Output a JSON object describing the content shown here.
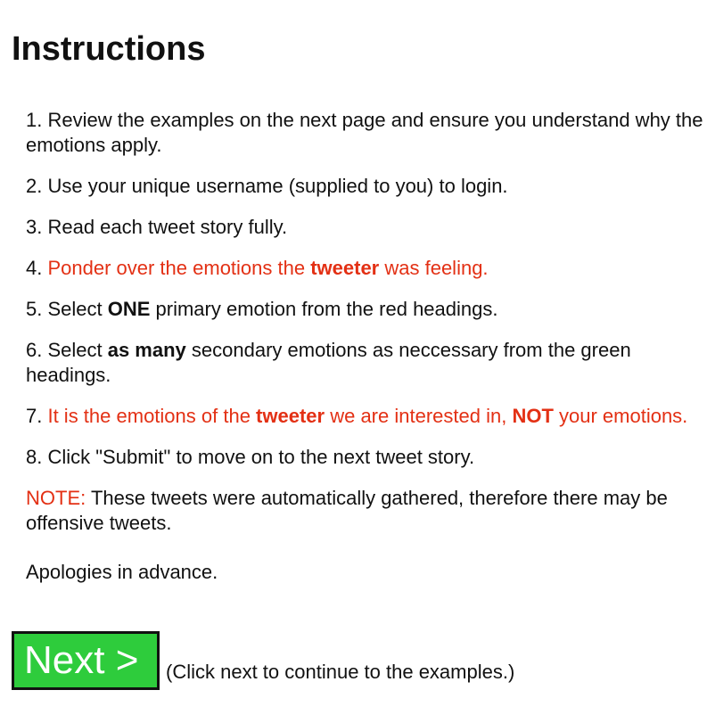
{
  "page": {
    "title": "Instructions"
  },
  "instructions": {
    "step1": {
      "text": "1. Review the examples on the next page and ensure you understand why the emotions apply."
    },
    "step2": {
      "text": "2. Use your unique username (supplied to you) to login."
    },
    "step3": {
      "text": "3. Read each tweet story fully."
    },
    "step4": {
      "prefix": "4. ",
      "text_before": "Ponder over the emotions the ",
      "bold": "tweeter",
      "text_after": " was feeling."
    },
    "step5": {
      "text_before": "5. Select ",
      "bold": "ONE",
      "text_after": " primary emotion from the red headings."
    },
    "step6": {
      "text_before": "6. Select ",
      "bold": "as many",
      "text_after": " secondary emotions as neccessary from the green headings."
    },
    "step7": {
      "prefix": "7. ",
      "text_before": "It is the emotions of the ",
      "bold1": "tweeter",
      "text_middle": " we are interested in, ",
      "bold2": "NOT",
      "text_after": " your emotions."
    },
    "step8": {
      "text": "8. Click \"Submit\" to move on to the next tweet story."
    },
    "note": {
      "label": "NOTE:",
      "text": " These tweets were automatically gathered, therefore there may be offensive tweets."
    },
    "apology": "Apologies in advance."
  },
  "footer": {
    "next_label": "Next >",
    "hint": "(Click next to continue to the examples.)"
  },
  "colors": {
    "highlight": "#e33014",
    "next_button": "#2ecc3c",
    "text": "#111111"
  }
}
